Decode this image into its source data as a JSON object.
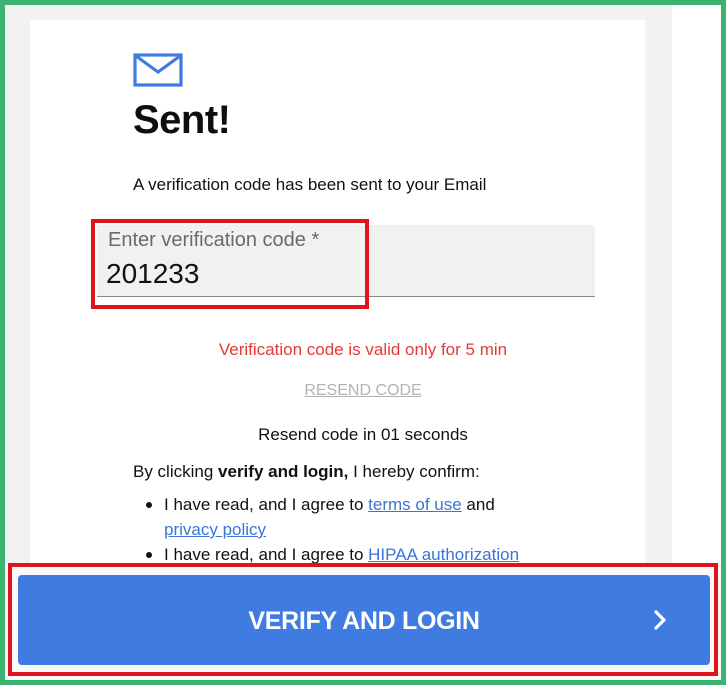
{
  "header": {
    "title": "Sent!",
    "subtitle": "A verification code has been sent to your Email"
  },
  "code_field": {
    "label": "Enter verification code *",
    "value": "201233"
  },
  "notes": {
    "validity": "Verification code is valid only for 5 min",
    "resend_link": "RESEND CODE",
    "resend_timer": "Resend code in 01 seconds"
  },
  "confirm": {
    "prefix": "By clicking ",
    "bold": "verify and login,",
    "suffix": " I hereby confirm:"
  },
  "agreements": [
    {
      "text": "I have read, and I agree to ",
      "link": "terms of use",
      "mid": " and ",
      "link2": "privacy policy"
    },
    {
      "text": "I have read, and I agree to ",
      "link": "HIPAA authorization"
    }
  ],
  "button": {
    "label": "VERIFY AND LOGIN",
    "icon": "chevron-right-icon"
  },
  "icons": {
    "header_icon": "mail-icon"
  },
  "colors": {
    "accent": "#3f7be0",
    "error": "#e53935",
    "link": "#3b73d9",
    "highlight": "#e0141d",
    "frame": "#3cb371"
  }
}
